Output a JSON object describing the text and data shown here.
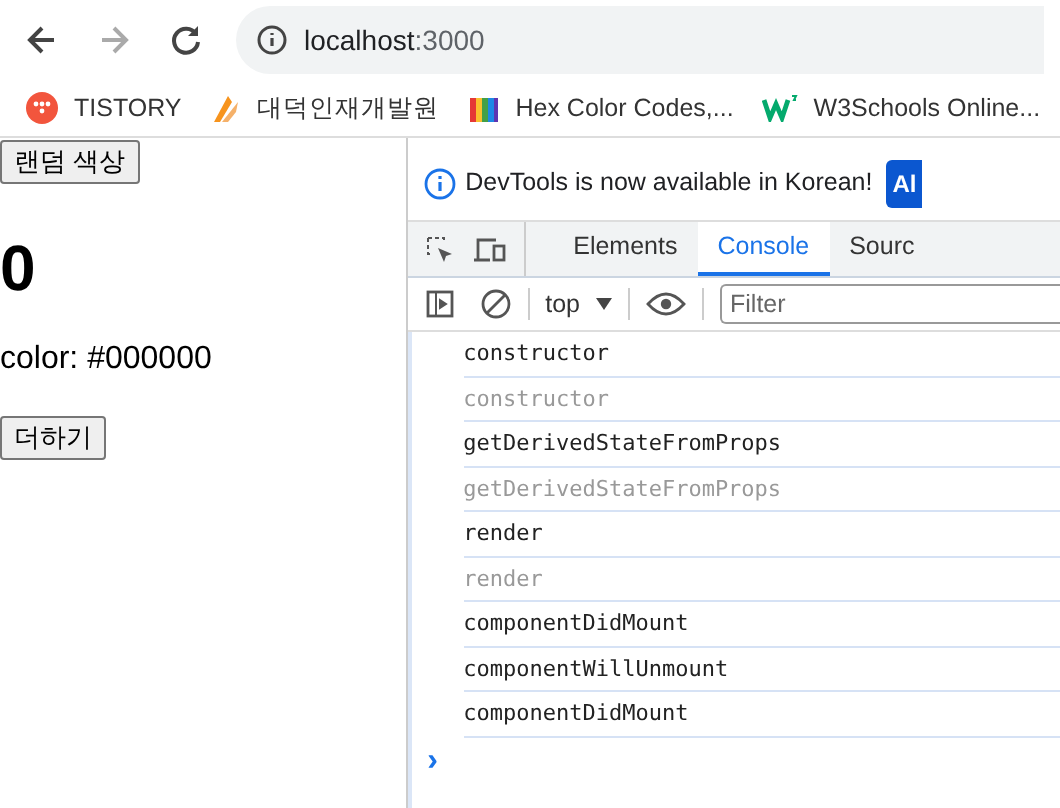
{
  "address_bar": {
    "url_host": "localhost",
    "url_port": ":3000"
  },
  "bookmarks": [
    {
      "label": "TISTORY",
      "kind": "tistory"
    },
    {
      "label": "대덕인재개발원",
      "kind": "flame"
    },
    {
      "label": "Hex Color Codes,...",
      "kind": "book"
    },
    {
      "label": "W3Schools Online...",
      "kind": "w3"
    }
  ],
  "page": {
    "random_button": "랜덤 색상",
    "count": "0",
    "color_text": "color: #000000",
    "add_button": "더하기"
  },
  "devtools": {
    "notice": "DevTools is now available in Korean!",
    "notice_button": "Al",
    "tabs": [
      {
        "label": "Elements",
        "selected": false
      },
      {
        "label": "Console",
        "selected": true
      },
      {
        "label": "Sourc",
        "selected": false
      }
    ],
    "context": "top",
    "filter": {
      "placeholder": "Filter"
    },
    "logs": [
      {
        "text": "constructor",
        "dimmed": false
      },
      {
        "text": "constructor",
        "dimmed": true
      },
      {
        "text": "getDerivedStateFromProps",
        "dimmed": false
      },
      {
        "text": "getDerivedStateFromProps",
        "dimmed": true
      },
      {
        "text": "render",
        "dimmed": false
      },
      {
        "text": "render",
        "dimmed": true
      },
      {
        "text": "componentDidMount",
        "dimmed": false
      },
      {
        "text": "componentWillUnmount",
        "dimmed": false
      },
      {
        "text": "componentDidMount",
        "dimmed": false
      }
    ],
    "prompt": "›"
  }
}
